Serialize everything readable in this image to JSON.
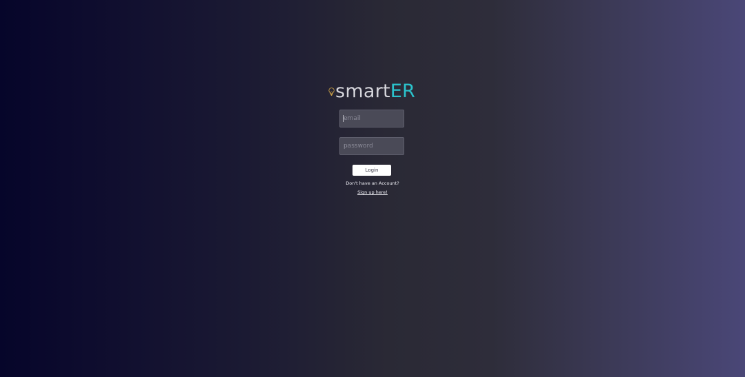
{
  "brand": {
    "name_part1": "smart",
    "name_part2": "ER",
    "icon": "lightbulb-icon",
    "colors": {
      "primary_text": "#d6d6dc",
      "accent": "#2bc3cc",
      "bulb": "#e6b54a"
    }
  },
  "form": {
    "email": {
      "placeholder": "email",
      "value": ""
    },
    "password": {
      "placeholder": "password",
      "value": ""
    },
    "login_label": "Login",
    "signup_prompt": "Don't have an Account?",
    "signup_link": "Sign up here!"
  }
}
